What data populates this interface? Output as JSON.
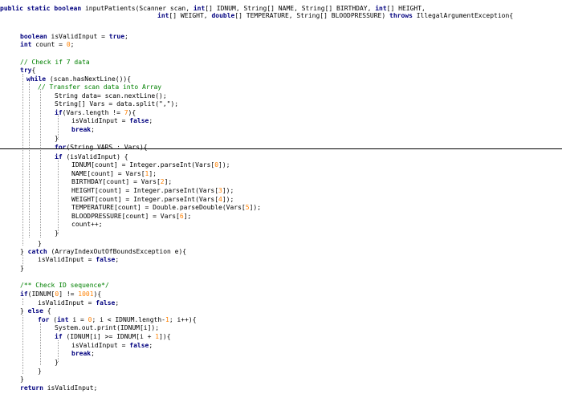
{
  "editor": {
    "language": "java",
    "divider_after_line": 17,
    "colors": {
      "keyword": "#00007f",
      "comment": "#008000",
      "number": "#ff8000",
      "text": "#000000",
      "guide": "#9a9a9a"
    },
    "lines": [
      {
        "i": 0,
        "c": 0,
        "tokens": [
          [
            "kw",
            "public static boolean"
          ],
          [
            "tx",
            " inputPatients(Scanner scan, "
          ],
          [
            "kw",
            "int"
          ],
          [
            "tx",
            "[] IDNUM, String[] NAME, String[] BIRTHDAY, "
          ],
          [
            "kw",
            "int"
          ],
          [
            "tx",
            "[] HEIGHT,"
          ]
        ]
      },
      {
        "i": 0,
        "c": 196,
        "tokens": [
          [
            "kw",
            "int"
          ],
          [
            "tx",
            "[] WEIGHT, "
          ],
          [
            "kw",
            "double"
          ],
          [
            "tx",
            "[] TEMPERATURE, String[] BLOODPRESSURE) "
          ],
          [
            "kw",
            "throws"
          ],
          [
            "tx",
            " IllegalArgumentException{"
          ]
        ]
      },
      {
        "i": 2,
        "c": 0,
        "tokens": []
      },
      {
        "i": 3,
        "c": 25,
        "tokens": [
          [
            "kw",
            "boolean"
          ],
          [
            "tx",
            " isValidInput = "
          ],
          [
            "kw",
            "true"
          ],
          [
            "tx",
            ";"
          ]
        ]
      },
      {
        "i": 4,
        "c": 25,
        "tokens": [
          [
            "kw",
            "int"
          ],
          [
            "tx",
            " count = "
          ],
          [
            "num",
            "0"
          ],
          [
            "tx",
            ";"
          ]
        ]
      },
      {
        "i": 5,
        "c": 0,
        "tokens": []
      },
      {
        "i": 6,
        "c": 25,
        "tokens": [
          [
            "cm",
            "// Check if 7 data"
          ]
        ]
      },
      {
        "i": 7,
        "c": 25,
        "tokens": [
          [
            "kw",
            "try"
          ],
          [
            "tx",
            "{"
          ]
        ]
      },
      {
        "i": 8,
        "c": 33,
        "tokens": [
          [
            "kw",
            "while"
          ],
          [
            "tx",
            " (scan.hasNextLine()){"
          ]
        ]
      },
      {
        "i": 9,
        "c": 47,
        "tokens": [
          [
            "cm",
            "// Transfer scan data into Array"
          ]
        ]
      },
      {
        "i": 10,
        "c": 68,
        "tokens": [
          [
            "tx",
            "String data= scan.nextLine();"
          ]
        ]
      },
      {
        "i": 11,
        "c": 68,
        "tokens": [
          [
            "tx",
            "String[] Vars = data.split(\",\");"
          ]
        ]
      },
      {
        "i": 12,
        "c": 68,
        "tokens": [
          [
            "kw",
            "if"
          ],
          [
            "tx",
            "(Vars.length != "
          ],
          [
            "num",
            "7"
          ],
          [
            "tx",
            "){"
          ]
        ]
      },
      {
        "i": 13,
        "c": 89,
        "tokens": [
          [
            "tx",
            "isValidInput = "
          ],
          [
            "kw",
            "false"
          ],
          [
            "tx",
            ";"
          ]
        ]
      },
      {
        "i": 14,
        "c": 89,
        "tokens": [
          [
            "kw",
            "break"
          ],
          [
            "tx",
            ";"
          ]
        ]
      },
      {
        "i": 15,
        "c": 68,
        "tokens": [
          [
            "tx",
            "}"
          ]
        ]
      },
      {
        "i": 16,
        "c": 68,
        "tokens": [
          [
            "kw",
            "for"
          ],
          [
            "tx",
            "(String VARS : Vars){"
          ]
        ]
      },
      {
        "i": 17,
        "c": 68,
        "tokens": [
          [
            "kw",
            "if"
          ],
          [
            "tx",
            " (isValidInput) {"
          ]
        ]
      },
      {
        "i": 18,
        "c": 89,
        "tokens": [
          [
            "tx",
            "IDNUM[count] = Integer.parseInt(Vars["
          ],
          [
            "num",
            "0"
          ],
          [
            "tx",
            "]);"
          ]
        ]
      },
      {
        "i": 19,
        "c": 89,
        "tokens": [
          [
            "tx",
            "NAME[count] = Vars["
          ],
          [
            "num",
            "1"
          ],
          [
            "tx",
            "];"
          ]
        ]
      },
      {
        "i": 20,
        "c": 89,
        "tokens": [
          [
            "tx",
            "BIRTHDAY[count] = Vars["
          ],
          [
            "num",
            "2"
          ],
          [
            "tx",
            "];"
          ]
        ]
      },
      {
        "i": 21,
        "c": 89,
        "tokens": [
          [
            "tx",
            "HEIGHT[count] = Integer.parseInt(Vars["
          ],
          [
            "num",
            "3"
          ],
          [
            "tx",
            "]);"
          ]
        ]
      },
      {
        "i": 22,
        "c": 89,
        "tokens": [
          [
            "tx",
            "WEIGHT[count] = Integer.parseInt(Vars["
          ],
          [
            "num",
            "4"
          ],
          [
            "tx",
            "]);"
          ]
        ]
      },
      {
        "i": 23,
        "c": 89,
        "tokens": [
          [
            "tx",
            "TEMPERATURE[count] = Double.parseDouble(Vars["
          ],
          [
            "num",
            "5"
          ],
          [
            "tx",
            "]);"
          ]
        ]
      },
      {
        "i": 24,
        "c": 89,
        "tokens": [
          [
            "tx",
            "BLOODPRESSURE[count] = Vars["
          ],
          [
            "num",
            "6"
          ],
          [
            "tx",
            "];"
          ]
        ]
      },
      {
        "i": 25,
        "c": 89,
        "tokens": [
          [
            "tx",
            "count++;"
          ]
        ]
      },
      {
        "i": 26,
        "c": 68,
        "tokens": [
          [
            "tx",
            "}"
          ]
        ]
      },
      {
        "i": 27,
        "c": 0,
        "tokens": []
      },
      {
        "i": 28,
        "c": 47,
        "tokens": [
          [
            "tx",
            "}"
          ]
        ]
      },
      {
        "i": 29,
        "c": 25,
        "tokens": [
          [
            "tx",
            "} "
          ],
          [
            "kw",
            "catch"
          ],
          [
            "tx",
            " (ArrayIndexOutOfBoundsException e){"
          ]
        ]
      },
      {
        "i": 30,
        "c": 47,
        "tokens": [
          [
            "tx",
            "isValidInput = "
          ],
          [
            "kw",
            "false"
          ],
          [
            "tx",
            ";"
          ]
        ]
      },
      {
        "i": 31,
        "c": 25,
        "tokens": [
          [
            "tx",
            "}"
          ]
        ]
      },
      {
        "i": 32,
        "c": 0,
        "tokens": []
      },
      {
        "i": 33,
        "c": 25,
        "tokens": [
          [
            "cm",
            "/** Check ID sequence*/"
          ]
        ]
      },
      {
        "i": 34,
        "c": 25,
        "tokens": [
          [
            "kw",
            "if"
          ],
          [
            "tx",
            "(IDNUM["
          ],
          [
            "num",
            "0"
          ],
          [
            "tx",
            "] != "
          ],
          [
            "num",
            "1001"
          ],
          [
            "tx",
            "){"
          ]
        ]
      },
      {
        "i": 35,
        "c": 47,
        "tokens": [
          [
            "tx",
            "isValidInput = "
          ],
          [
            "kw",
            "false"
          ],
          [
            "tx",
            ";"
          ]
        ]
      },
      {
        "i": 36,
        "c": 25,
        "tokens": [
          [
            "tx",
            "} "
          ],
          [
            "kw",
            "else"
          ],
          [
            "tx",
            " {"
          ]
        ]
      },
      {
        "i": 37,
        "c": 47,
        "tokens": [
          [
            "kw",
            "for"
          ],
          [
            "tx",
            " ("
          ],
          [
            "kw",
            "int"
          ],
          [
            "tx",
            " i = "
          ],
          [
            "num",
            "0"
          ],
          [
            "tx",
            "; i < IDNUM.length-"
          ],
          [
            "num",
            "1"
          ],
          [
            "tx",
            "; i++){"
          ]
        ]
      },
      {
        "i": 38,
        "c": 68,
        "tokens": [
          [
            "tx",
            "System.out.print(IDNUM[i]);"
          ]
        ]
      },
      {
        "i": 39,
        "c": 68,
        "tokens": [
          [
            "kw",
            "if"
          ],
          [
            "tx",
            " (IDNUM[i] >= IDNUM[i + "
          ],
          [
            "num",
            "1"
          ],
          [
            "tx",
            "]){"
          ]
        ]
      },
      {
        "i": 40,
        "c": 89,
        "tokens": [
          [
            "tx",
            "isValidInput = "
          ],
          [
            "kw",
            "false"
          ],
          [
            "tx",
            ";"
          ]
        ]
      },
      {
        "i": 41,
        "c": 89,
        "tokens": [
          [
            "kw",
            "break"
          ],
          [
            "tx",
            ";"
          ]
        ]
      },
      {
        "i": 42,
        "c": 68,
        "tokens": [
          [
            "tx",
            "}"
          ]
        ]
      },
      {
        "i": 43,
        "c": 47,
        "tokens": [
          [
            "tx",
            "}"
          ]
        ]
      },
      {
        "i": 44,
        "c": 25,
        "tokens": [
          [
            "tx",
            "}"
          ]
        ]
      },
      {
        "i": 45,
        "c": 25,
        "tokens": [
          [
            "kw",
            "return"
          ],
          [
            "tx",
            " isValidInput;"
          ]
        ]
      }
    ]
  }
}
